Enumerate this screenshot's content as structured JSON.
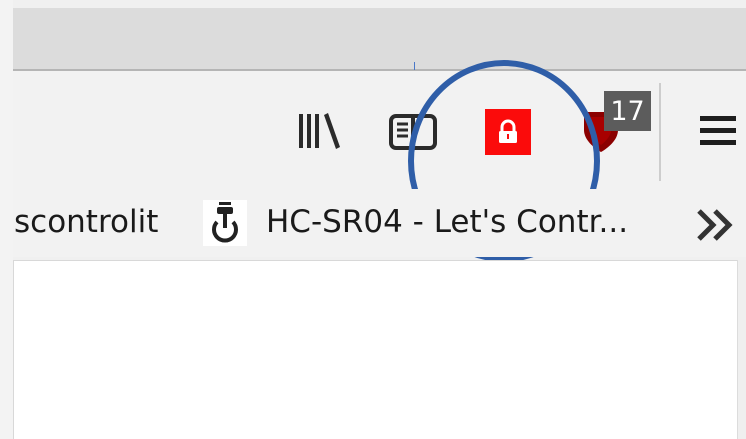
{
  "toolbar": {
    "library_icon": "library-icon",
    "reader_icon": "reader-view-icon",
    "lock_icon": "lock-icon",
    "lock_color": "#fb0b0b",
    "shield_icon": "shield-extension-icon",
    "shield_badge": "17",
    "menu_icon": "hamburger-menu-icon"
  },
  "bookmarks": {
    "items": [
      {
        "label": "scontrolit"
      },
      {
        "label": "HC-SR04 - Let's Contr...",
        "icon": "power-favicon-icon"
      }
    ],
    "overflow_icon": "double-chevron-right-icon"
  },
  "annotation": {
    "color": "#2f5ea8"
  }
}
